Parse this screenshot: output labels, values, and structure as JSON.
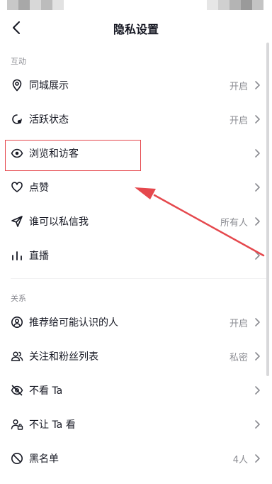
{
  "header": {
    "title": "隐私设置"
  },
  "sections": [
    {
      "label": "互动",
      "items": [
        {
          "label": "同城展示",
          "value": "开启",
          "icon": "location-pin-icon"
        },
        {
          "label": "活跃状态",
          "value": "开启",
          "icon": "active-status-icon"
        },
        {
          "label": "浏览和访客",
          "value": "",
          "icon": "eye-icon"
        },
        {
          "label": "点赞",
          "value": "",
          "icon": "heart-icon"
        },
        {
          "label": "谁可以私信我",
          "value": "所有人",
          "icon": "send-icon"
        },
        {
          "label": "直播",
          "value": "",
          "icon": "bars-icon"
        }
      ]
    },
    {
      "label": "关系",
      "items": [
        {
          "label": "推荐给可能认识的人",
          "value": "开启",
          "icon": "user-circle-icon"
        },
        {
          "label": "关注和粉丝列表",
          "value": "私密",
          "icon": "users-icon"
        },
        {
          "label": "不看 Ta",
          "value": "",
          "icon": "eye-off-icon"
        },
        {
          "label": "不让 Ta 看",
          "value": "",
          "icon": "user-lock-icon"
        },
        {
          "label": "黑名单",
          "value": "4人",
          "icon": "block-icon"
        }
      ]
    }
  ],
  "colors": {
    "text": "#161823",
    "secondary": "#8a8b91",
    "annotation": "#e5484d"
  }
}
